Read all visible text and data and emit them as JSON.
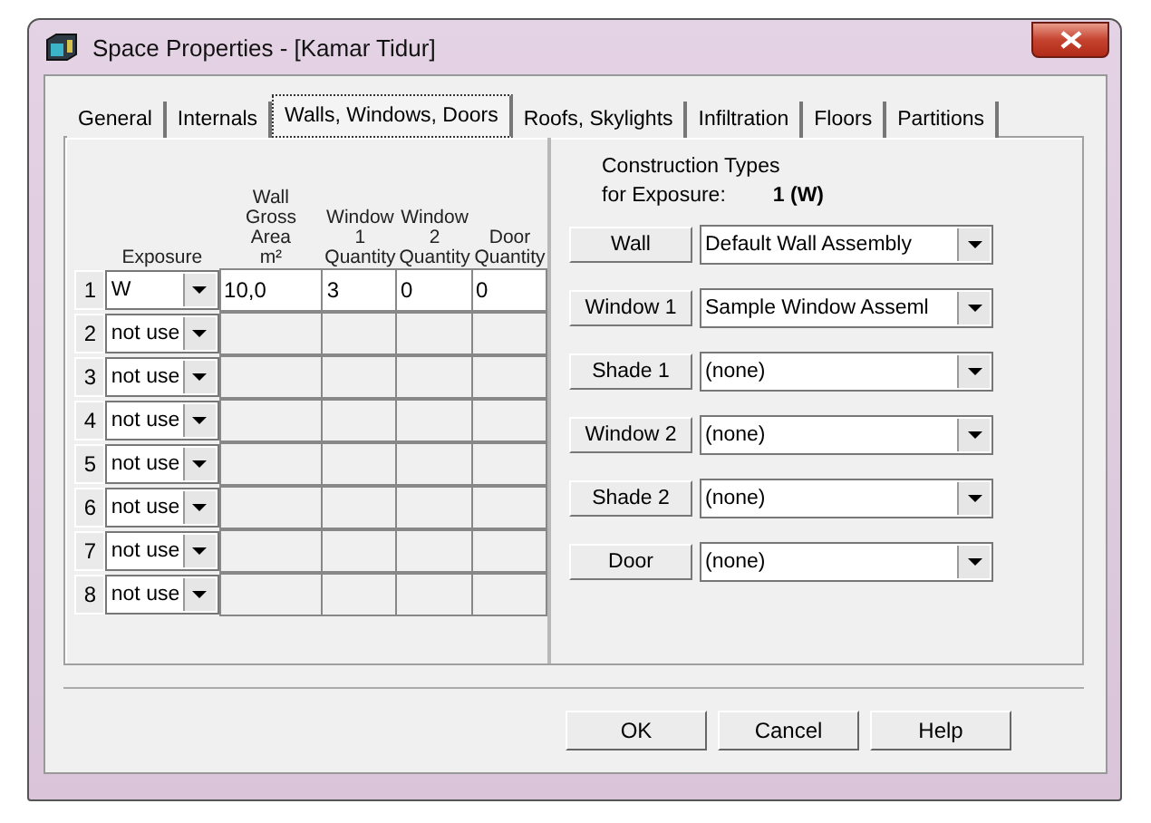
{
  "window": {
    "title": "Space Properties - [Kamar Tidur]"
  },
  "tabs": [
    {
      "label": "General",
      "selected": false
    },
    {
      "label": "Internals",
      "selected": false
    },
    {
      "label": "Walls, Windows, Doors",
      "selected": true
    },
    {
      "label": "Roofs, Skylights",
      "selected": false
    },
    {
      "label": "Infiltration",
      "selected": false
    },
    {
      "label": "Floors",
      "selected": false
    },
    {
      "label": "Partitions",
      "selected": false
    }
  ],
  "grid": {
    "columns": [
      "",
      "Exposure",
      "Wall\nGross\nArea\nm²",
      "Window\n1\nQuantity",
      "Window\n2\nQuantity",
      "Door\nQuantity"
    ],
    "rows": [
      {
        "cells": [
          "1",
          "W",
          "10,0",
          "3",
          "0",
          "0"
        ],
        "enabled": true
      },
      {
        "cells": [
          "2",
          "not use",
          "",
          "",
          "",
          ""
        ],
        "enabled": false
      },
      {
        "cells": [
          "3",
          "not use",
          "",
          "",
          "",
          ""
        ],
        "enabled": false
      },
      {
        "cells": [
          "4",
          "not use",
          "",
          "",
          "",
          ""
        ],
        "enabled": false
      },
      {
        "cells": [
          "5",
          "not use",
          "",
          "",
          "",
          ""
        ],
        "enabled": false
      },
      {
        "cells": [
          "6",
          "not use",
          "",
          "",
          "",
          ""
        ],
        "enabled": false
      },
      {
        "cells": [
          "7",
          "not use",
          "",
          "",
          "",
          ""
        ],
        "enabled": false
      },
      {
        "cells": [
          "8",
          "not use",
          "",
          "",
          "",
          ""
        ],
        "enabled": false
      }
    ]
  },
  "construction": {
    "heading": "Construction Types",
    "exposure_label": "for Exposure:",
    "exposure_value": "1 (W)",
    "items": [
      {
        "button": "Wall",
        "value": "Default Wall Assembly"
      },
      {
        "button": "Window 1",
        "value": "Sample Window Asseml"
      },
      {
        "button": "Shade 1",
        "value": "(none)"
      },
      {
        "button": "Window 2",
        "value": "(none)"
      },
      {
        "button": "Shade 2",
        "value": "(none)"
      },
      {
        "button": "Door",
        "value": "(none)"
      }
    ]
  },
  "buttons": [
    "OK",
    "Cancel",
    "Help"
  ]
}
